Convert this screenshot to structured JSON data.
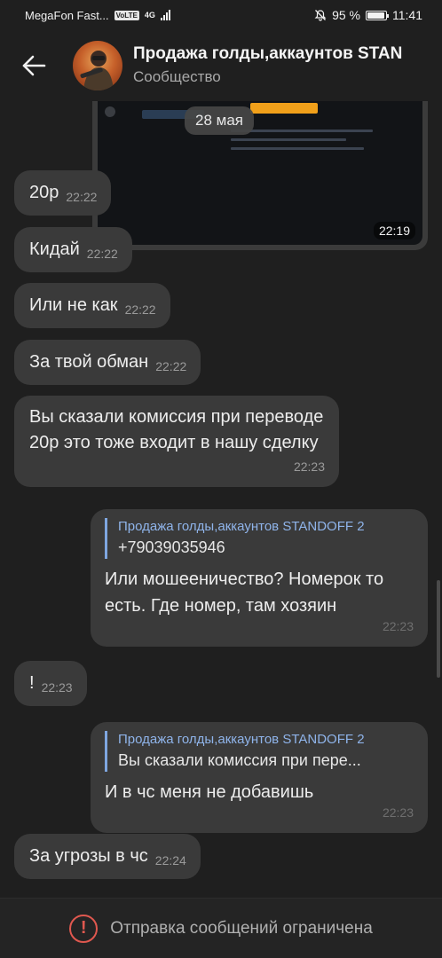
{
  "status_bar": {
    "carrier": "MegaFon Fast...",
    "volte": "VoLTE",
    "network": "4G",
    "battery": "95 %",
    "battery_level": 0.95,
    "time": "11:41"
  },
  "header": {
    "title": "Продажа голды,аккаунтов STAN",
    "subtitle": "Сообщество"
  },
  "media": {
    "time": "22:19"
  },
  "date_label": "28 мая",
  "messages": [
    {
      "text": "20р",
      "time": "22:22"
    },
    {
      "text": "Кидай",
      "time": "22:22"
    },
    {
      "text": "Или не как",
      "time": "22:22"
    },
    {
      "text": "За твой обман",
      "time": "22:22"
    },
    {
      "text": "Вы сказали комиссия при переводе 20р это тоже входит в нашу сделку",
      "time": "22:23"
    },
    {
      "reply_name": "Продажа голды,аккаунтов STANDOFF 2",
      "reply_text": "+79039035946",
      "text": "Или мошееничество? Номерок то есть. Где номер, там хозяин",
      "time": "22:23"
    },
    {
      "text": "!",
      "time": "22:23"
    },
    {
      "reply_name": "Продажа голды,аккаунтов STANDOFF 2",
      "reply_text": "Вы сказали комиссия при пере...",
      "text": "И в чс меня не добавишь",
      "time": "22:23"
    },
    {
      "text": "За угрозы в чс",
      "time": "22:24"
    }
  ],
  "bottom": {
    "restricted": "Отправка сообщений ограничена"
  }
}
